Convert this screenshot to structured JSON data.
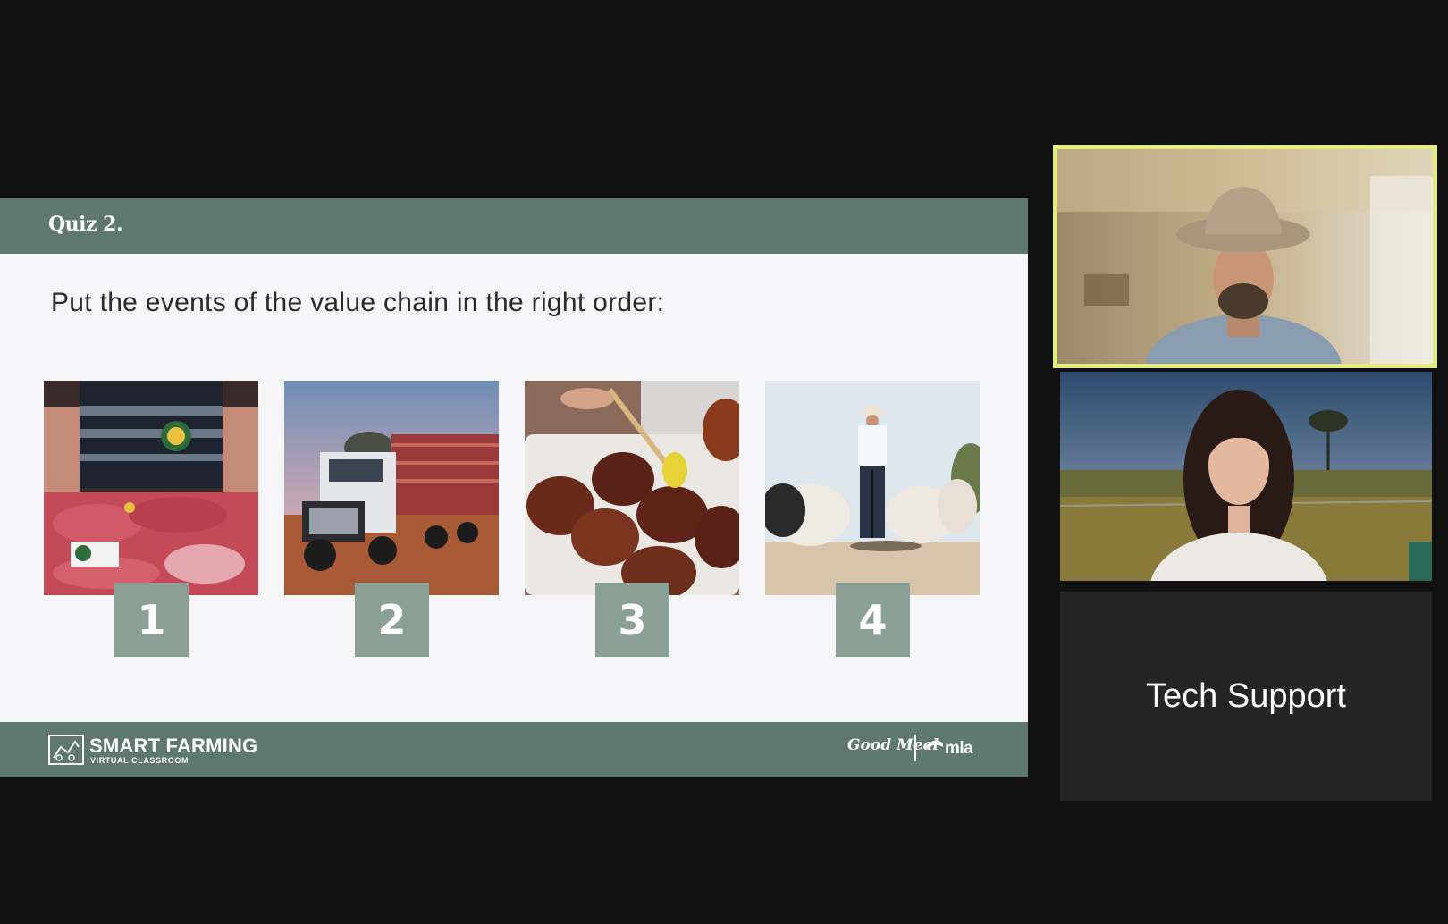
{
  "slide": {
    "title": "Quiz 2.",
    "question": "Put the events of the value chain in the right order:",
    "cards": [
      {
        "number": "1",
        "image": "butcher-meat-photo"
      },
      {
        "number": "2",
        "image": "cattle-truck-photo"
      },
      {
        "number": "3",
        "image": "grilled-chops-photo"
      },
      {
        "number": "4",
        "image": "farmer-cattle-photo"
      }
    ],
    "footer": {
      "brand_name": "SMART FARMING",
      "brand_sub": "VIRTUAL CLASSROOM",
      "partner_good_meal": "Good Meal",
      "partner_mla": "mla"
    }
  },
  "participants": [
    {
      "name": "",
      "active_speaker": true
    },
    {
      "name": ""
    },
    {
      "name": "Tech Support"
    }
  ],
  "colors": {
    "slide_band": "#5f786f",
    "badge": "#8aa096",
    "active_speaker_border": "#e4ec7e",
    "background": "#111111"
  }
}
